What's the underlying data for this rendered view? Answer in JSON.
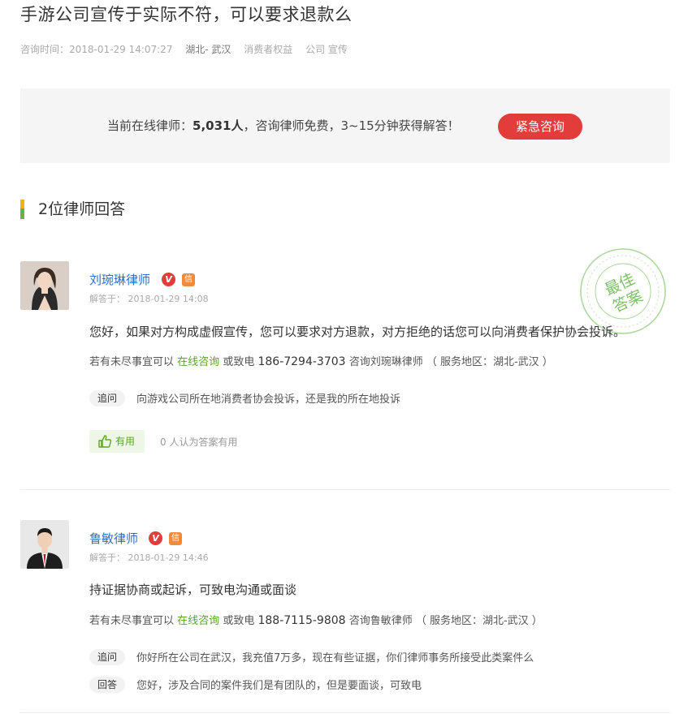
{
  "question": {
    "title": "手游公司宣传于实际不符，可以要求退款么",
    "time_label": "咨询时间：2018-01-29 14:07:27",
    "location": "湖北- 武汉",
    "tags": [
      "消费者权益",
      "公司 宣传"
    ]
  },
  "banner": {
    "prefix": "当前在线律师：",
    "count": "5,031人",
    "suffix": "，咨询律师免费，3~15分钟获得解答！",
    "button_label": "紧急咨询",
    "button_color": "#e23d3b"
  },
  "section": {
    "title": "2位律师回答"
  },
  "stamp": {
    "line1": "最佳",
    "line2": "答案",
    "color": "#7fbf6a"
  },
  "answers": [
    {
      "lawyer_name": "刘琬琳律师",
      "v_badge": "V",
      "xin_badge": "信",
      "answered_at": "解答于： 2018-01-29 14:08",
      "text": "您好，如果对方构成虚假宣传，您可以要求对方退款，对方拒绝的话您可以向消费者保护协会投诉。",
      "contact_prefix": "若有未尽事宜可以",
      "contact_online": "在线咨询",
      "contact_mid": "或致电",
      "phone": "186-7294-3703",
      "contact_suffix": "咨询刘琬琳律师 （ 服务地区：湖北-武汉 ）",
      "followups": [
        {
          "tag": "追问",
          "text": "向游戏公司所在地消费者协会投诉，还是我的所在地投诉"
        }
      ],
      "useful_label": "有用",
      "useful_count": "0 人认为答案有用"
    },
    {
      "lawyer_name": "鲁敏律师",
      "v_badge": "V",
      "xin_badge": "信",
      "answered_at": "解答于： 2018-01-29 14:46",
      "text": "持证据协商或起诉，可致电沟通或面谈",
      "contact_prefix": "若有未尽事宜可以",
      "contact_online": "在线咨询",
      "contact_mid": "或致电",
      "phone": "188-7115-9808",
      "contact_suffix": "咨询鲁敏律师 （ 服务地区：湖北-武汉 ）",
      "followups": [
        {
          "tag": "追问",
          "text": "你好所在公司在武汉，我充值7万多，现在有些证据，你们律师事务所接受此类案件么"
        },
        {
          "tag": "回答",
          "text": "您好，涉及合同的案件我们是有团队的，但是要面谈，可致电"
        }
      ]
    }
  ]
}
